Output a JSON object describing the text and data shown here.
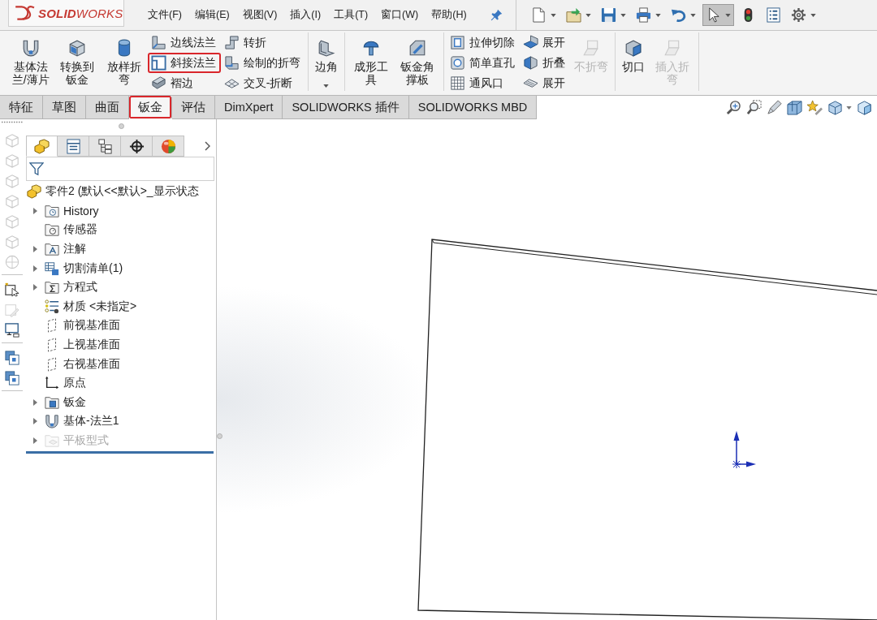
{
  "logo": {
    "wordmark": "**SOLID**WORKS"
  },
  "menu": [
    "文件(F)",
    "编辑(E)",
    "视图(V)",
    "插入(I)",
    "工具(T)",
    "窗口(W)",
    "帮助(H)"
  ],
  "quick_access": [
    {
      "dropdown": true,
      "pressed": false
    },
    {
      "dropdown": true,
      "pressed": false
    },
    {
      "dropdown": true,
      "pressed": false
    },
    {
      "dropdown": true,
      "pressed": false
    },
    {
      "dropdown": true,
      "pressed": false
    },
    {
      "dropdown": true,
      "pressed": true
    },
    {
      "dropdown": false,
      "pressed": false
    },
    {
      "dropdown": false,
      "pressed": false
    },
    {
      "dropdown": true,
      "pressed": false
    }
  ],
  "ribbon": [
    {
      "tools": [
        {
          "kind": "large",
          "label": "基体法兰/薄片",
          "disabled": false,
          "highlighted": false,
          "dropdown": false
        },
        {
          "kind": "large",
          "label": "转换到钣金",
          "disabled": false,
          "highlighted": false,
          "dropdown": false
        },
        {
          "kind": "large",
          "label": "放样折弯",
          "disabled": false,
          "highlighted": false,
          "dropdown": false
        },
        {
          "kind": "stack",
          "items": [
            {
              "label": "边线法兰",
              "disabled": false,
              "highlighted": false
            },
            {
              "label": "斜接法兰",
              "disabled": false,
              "highlighted": true
            },
            {
              "label": "褶边",
              "disabled": false,
              "highlighted": false
            }
          ]
        },
        {
          "kind": "stack",
          "items": [
            {
              "label": "转折",
              "disabled": false,
              "highlighted": false
            },
            {
              "label": "绘制的折弯",
              "disabled": false,
              "highlighted": false
            },
            {
              "label": "交叉-折断",
              "disabled": false,
              "highlighted": false
            }
          ]
        }
      ]
    },
    {
      "tools": [
        {
          "kind": "large",
          "label": "边角",
          "disabled": false,
          "highlighted": false,
          "dropdown": true
        }
      ]
    },
    {
      "tools": [
        {
          "kind": "large",
          "label": "成形工具",
          "disabled": false,
          "highlighted": false,
          "dropdown": false
        },
        {
          "kind": "large",
          "label": "钣金角撑板",
          "disabled": false,
          "highlighted": false,
          "dropdown": false
        }
      ]
    },
    {
      "tools": [
        {
          "kind": "stack",
          "items": [
            {
              "label": "拉伸切除",
              "disabled": false,
              "highlighted": false
            },
            {
              "label": "简单直孔",
              "disabled": false,
              "highlighted": false
            },
            {
              "label": "通风口",
              "disabled": false,
              "highlighted": false
            }
          ]
        },
        {
          "kind": "stack",
          "items": [
            {
              "label": "展开",
              "disabled": false,
              "highlighted": false
            },
            {
              "label": "折叠",
              "disabled": false,
              "highlighted": false
            },
            {
              "label": "展开",
              "disabled": false,
              "highlighted": false
            }
          ]
        },
        {
          "kind": "large",
          "label": "不折弯",
          "disabled": true,
          "highlighted": false,
          "dropdown": false
        }
      ]
    },
    {
      "tools": [
        {
          "kind": "large",
          "label": "切口",
          "disabled": false,
          "highlighted": false,
          "dropdown": false
        },
        {
          "kind": "large",
          "label": "插入折弯",
          "disabled": true,
          "highlighted": false,
          "dropdown": false
        }
      ]
    }
  ],
  "tabs": [
    {
      "label": "特征",
      "selected": false,
      "highlighted": false
    },
    {
      "label": "草图",
      "selected": false,
      "highlighted": false
    },
    {
      "label": "曲面",
      "selected": false,
      "highlighted": false
    },
    {
      "label": "钣金",
      "selected": true,
      "highlighted": true
    },
    {
      "label": "评估",
      "selected": false,
      "highlighted": false
    },
    {
      "label": "DimXpert",
      "selected": false,
      "highlighted": false
    },
    {
      "label": "SOLIDWORKS 插件",
      "selected": false,
      "highlighted": false
    },
    {
      "label": "SOLIDWORKS MBD",
      "selected": false,
      "highlighted": false
    }
  ],
  "view_toolbar": [
    {
      "dropdown": false
    },
    {
      "dropdown": false
    },
    {
      "dropdown": false
    },
    {
      "dropdown": false
    },
    {
      "dropdown": false
    },
    {
      "dropdown": true
    },
    {
      "dropdown": false
    }
  ],
  "side_toolbar": [
    {
      "items": [
        {
          "disabled": true
        },
        {
          "disabled": true
        },
        {
          "disabled": true
        },
        {
          "disabled": true
        },
        {
          "disabled": true
        },
        {
          "disabled": true
        },
        {
          "disabled": true
        }
      ]
    },
    {
      "items": [
        {
          "disabled": false
        },
        {
          "disabled": true
        },
        {
          "disabled": false
        }
      ]
    },
    {
      "items": [
        {
          "disabled": false
        },
        {
          "disabled": false
        }
      ]
    }
  ],
  "panel_tabs": [
    {
      "selected": true
    },
    {
      "selected": false
    },
    {
      "selected": false
    },
    {
      "selected": false
    },
    {
      "selected": false
    }
  ],
  "feature_tree": {
    "label": "零件2 (默认<<默认>_显示状态",
    "children": [
      {
        "label": "History",
        "expanded": false,
        "suppressed": false
      },
      {
        "label": "传感器",
        "suppressed": false
      },
      {
        "label": "注解",
        "expanded": false,
        "suppressed": false
      },
      {
        "label": "切割清单(1)",
        "expanded": false,
        "suppressed": false
      },
      {
        "label": "方程式",
        "expanded": false,
        "suppressed": false
      },
      {
        "label": "材质 <未指定>",
        "suppressed": false
      },
      {
        "label": "前视基准面",
        "suppressed": false
      },
      {
        "label": "上视基准面",
        "suppressed": false
      },
      {
        "label": "右视基准面",
        "suppressed": false
      },
      {
        "label": "原点",
        "suppressed": false
      },
      {
        "label": "钣金",
        "expanded": false,
        "suppressed": false
      },
      {
        "label": "基体-法兰1",
        "expanded": false,
        "suppressed": false
      },
      {
        "label": "平板型式",
        "expanded": false,
        "suppressed": true
      }
    ]
  }
}
